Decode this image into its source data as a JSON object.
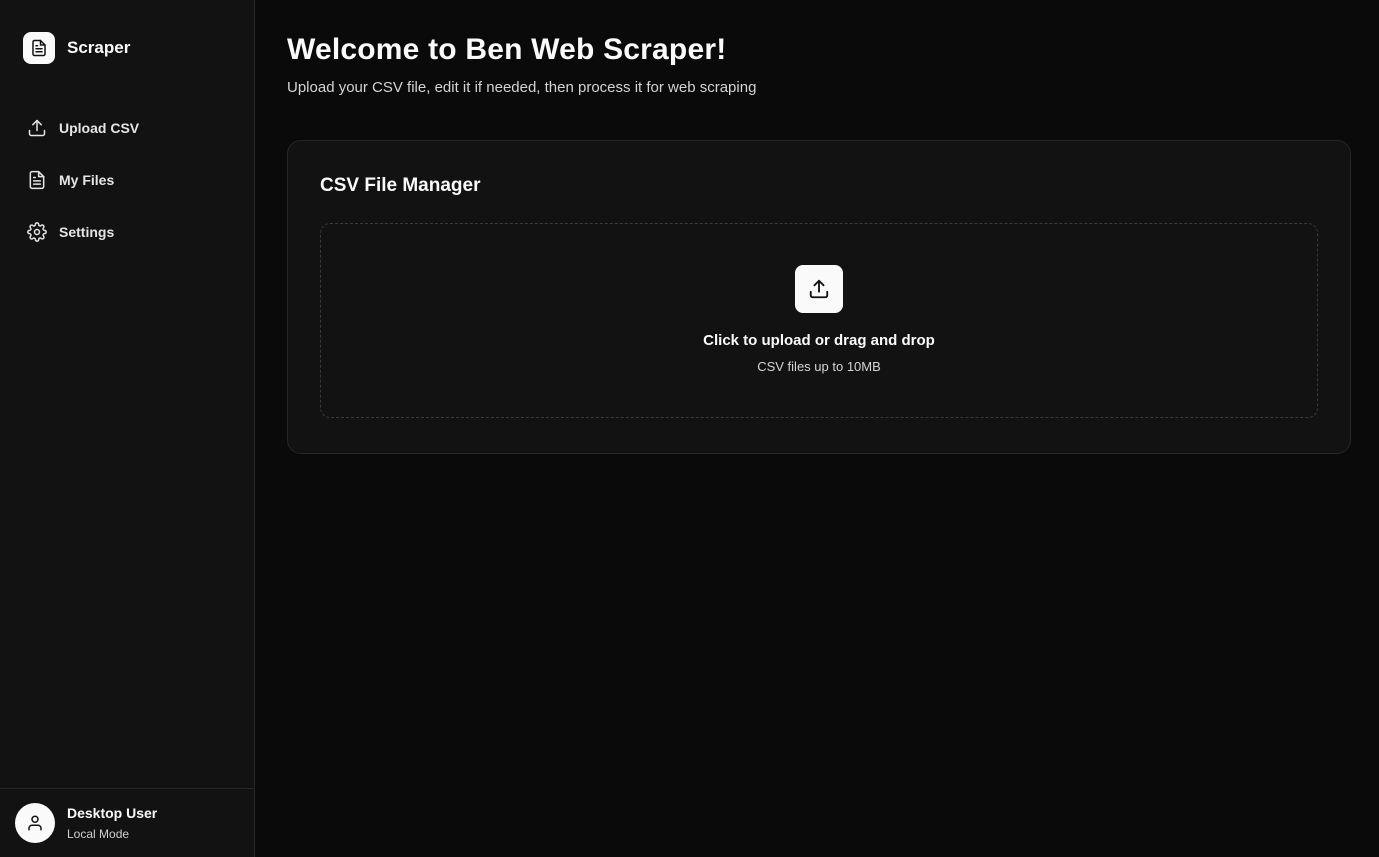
{
  "sidebar": {
    "brand": {
      "name": "Scraper",
      "icon": "file-text-icon"
    },
    "nav": [
      {
        "label": "Upload CSV",
        "icon": "upload-icon"
      },
      {
        "label": "My Files",
        "icon": "file-icon"
      },
      {
        "label": "Settings",
        "icon": "gear-icon"
      }
    ],
    "user": {
      "name": "Desktop User",
      "mode": "Local Mode",
      "icon": "user-icon"
    }
  },
  "main": {
    "title": "Welcome to Ben Web Scraper!",
    "subtitle": "Upload your CSV file, edit it if needed, then process it for web scraping",
    "card": {
      "title": "CSV File Manager",
      "dropzone": {
        "primary": "Click to upload or drag and drop",
        "secondary": "CSV files up to 10MB",
        "icon": "upload-icon"
      }
    }
  },
  "colors": {
    "background": "#0a0a0a",
    "sidebar": "#121212",
    "card": "#121212",
    "border": "#262626",
    "text": "#fafafa",
    "muted": "#d4d4d4"
  }
}
